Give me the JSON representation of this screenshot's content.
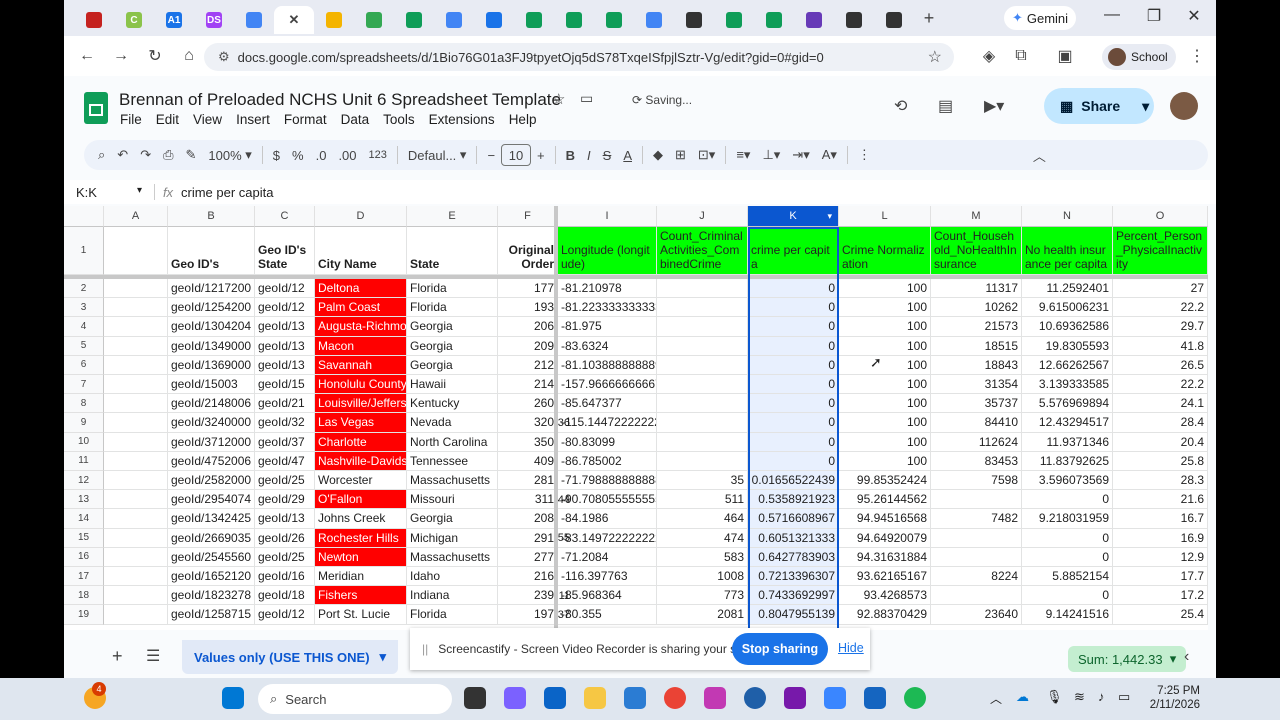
{
  "browser": {
    "tabs": [
      {
        "icon": "record-icon",
        "color": "#c5221f",
        "label": ""
      },
      {
        "icon": "c-icon",
        "color": "#8bc34a",
        "label": "C"
      },
      {
        "icon": "a1-icon",
        "color": "#1a73e8",
        "label": "A1"
      },
      {
        "icon": "ds-icon",
        "color": "#a142f4",
        "label": "DS"
      },
      {
        "icon": "docs-icon",
        "color": "#4285f4",
        "label": ""
      },
      {
        "icon": "close-icon",
        "color": "#444",
        "label": "✕",
        "active": true
      },
      {
        "icon": "slides-icon",
        "color": "#f4b400",
        "label": ""
      },
      {
        "icon": "drive-icon",
        "color": "#34a853",
        "label": ""
      },
      {
        "icon": "sheets-icon",
        "color": "#0f9d58",
        "label": ""
      },
      {
        "icon": "docs-icon",
        "color": "#4285f4",
        "label": ""
      },
      {
        "icon": "globe-icon",
        "color": "#1a73e8",
        "label": ""
      },
      {
        "icon": "sheets-icon",
        "color": "#0f9d58",
        "label": ""
      },
      {
        "icon": "sheets-icon",
        "color": "#0f9d58",
        "label": ""
      },
      {
        "icon": "sheets-icon",
        "color": "#0f9d58",
        "label": ""
      },
      {
        "icon": "docs-icon",
        "color": "#4285f4",
        "label": ""
      },
      {
        "icon": "openai-icon",
        "color": "#333",
        "label": ""
      },
      {
        "icon": "sheets-icon",
        "color": "#0f9d58",
        "label": ""
      },
      {
        "icon": "add-circle-icon",
        "color": "#0f9d58",
        "label": ""
      },
      {
        "icon": "forms-icon",
        "color": "#673ab7",
        "label": ""
      },
      {
        "icon": "github-icon",
        "color": "#333",
        "label": ""
      },
      {
        "icon": "github-icon",
        "color": "#333",
        "label": ""
      }
    ],
    "new_tab": "+",
    "gemini_label": "Gemini",
    "url": "docs.google.com/spreadsheets/d/1Bio76G01a3FJ9tpyetOjq5dS78TxqeISfpjlSztr-Vg/edit?gid=0#gid=0",
    "profile_label": "School"
  },
  "doc": {
    "title": "Brennan of Preloaded NCHS Unit 6 Spreadsheet Template",
    "status": "Saving...",
    "menu": [
      "File",
      "Edit",
      "View",
      "Insert",
      "Format",
      "Data",
      "Tools",
      "Extensions",
      "Help"
    ],
    "share_label": "Share"
  },
  "toolbar": {
    "zoom": "100%",
    "currency": "$",
    "percent": "%",
    "dec_decrease": ".0",
    "dec_increase": ".00",
    "number_format": "123",
    "font": "Defaul...",
    "font_size": "10",
    "bold": "B",
    "italic": "I",
    "strike": "S",
    "text_color": "A"
  },
  "formula_bar": {
    "name_box": "K:K",
    "fx": "fx",
    "content": "crime per capita"
  },
  "columns": [
    "A",
    "B",
    "C",
    "D",
    "E",
    "F",
    "I",
    "J",
    "K",
    "L",
    "M",
    "N",
    "O"
  ],
  "header_row": [
    "",
    "Geo ID's",
    "Geo ID's State",
    "City Name",
    "State",
    "Original Order",
    "Longitude (longitude)",
    "Count_Criminal Activities_CombinedCrime",
    "crime per capita",
    "Crime Normalization",
    "Count_Household_NoHealthInsurance",
    "No health insurance per capita",
    "Percent_Person_PhysicalInactivity"
  ],
  "rows": [
    {
      "n": "2",
      "cells": [
        "",
        "geoId/1217200",
        "geoId/12",
        "Deltona",
        "Florida",
        "177",
        "-81.210978",
        "",
        "0",
        "100",
        "11317",
        "11.2592401",
        "27"
      ],
      "red": true
    },
    {
      "n": "3",
      "cells": [
        "",
        "geoId/1254200",
        "geoId/12",
        "Palm Coast",
        "Florida",
        "193",
        "-81.223333333333",
        "",
        "0",
        "100",
        "10262",
        "9.615006231",
        "22.2"
      ],
      "red": true
    },
    {
      "n": "4",
      "cells": [
        "",
        "geoId/1304204",
        "geoId/13",
        "Augusta-Richmond",
        "Georgia",
        "206",
        "-81.975",
        "",
        "0",
        "100",
        "21573",
        "10.69362586",
        "29.7"
      ],
      "red": true
    },
    {
      "n": "5",
      "cells": [
        "",
        "geoId/1349000",
        "geoId/13",
        "Macon",
        "Georgia",
        "209",
        "-83.6324",
        "",
        "0",
        "100",
        "18515",
        "19.8305593",
        "41.8"
      ],
      "red": true
    },
    {
      "n": "6",
      "cells": [
        "",
        "geoId/1369000",
        "geoId/13",
        "Savannah",
        "Georgia",
        "212",
        "-81.103888888889",
        "",
        "0",
        "100",
        "18843",
        "12.66262567",
        "26.5"
      ],
      "red": true
    },
    {
      "n": "7",
      "cells": [
        "",
        "geoId/15003",
        "geoId/15",
        "Honolulu County",
        "Hawaii",
        "214",
        "-157.96666666667",
        "",
        "0",
        "100",
        "31354",
        "3.139333585",
        "22.2"
      ],
      "red": true
    },
    {
      "n": "8",
      "cells": [
        "",
        "geoId/2148006",
        "geoId/21",
        "Louisville/Jefferson",
        "Kentucky",
        "260",
        "-85.647377",
        "",
        "0",
        "100",
        "35737",
        "5.576969894",
        "24.1"
      ],
      "red": true
    },
    {
      "n": "9",
      "cells": [
        "",
        "geoId/3240000",
        "geoId/32",
        "Las Vegas",
        "Nevada",
        "320",
        "-115.14472222222",
        "",
        "0",
        "100",
        "84410",
        "12.43294517",
        "28.4"
      ],
      "red": true,
      "spill": "36"
    },
    {
      "n": "10",
      "cells": [
        "",
        "geoId/3712000",
        "geoId/37",
        "Charlotte",
        "North Carolina",
        "350",
        "-80.83099",
        "",
        "0",
        "100",
        "112624",
        "11.9371346",
        "20.4"
      ],
      "red": true
    },
    {
      "n": "11",
      "cells": [
        "",
        "geoId/4752006",
        "geoId/47",
        "Nashville-Davidson",
        "Tennessee",
        "409",
        "-86.785002",
        "",
        "0",
        "100",
        "83453",
        "11.83792625",
        "25.8"
      ],
      "red": true
    },
    {
      "n": "12",
      "cells": [
        "",
        "geoId/2582000",
        "geoId/25",
        "Worcester",
        "Massachusetts",
        "281",
        "-71.798888888888",
        "35",
        "0.01656522439",
        "99.85352424",
        "7598",
        "3.596073569",
        "28.3"
      ],
      "red": false
    },
    {
      "n": "13",
      "cells": [
        "",
        "geoId/2954074",
        "geoId/29",
        "O'Fallon",
        "Missouri",
        "311",
        "-90.708055555555",
        "511",
        "0.5358921923",
        "95.26144562",
        "",
        "0",
        "21.6"
      ],
      "red": true,
      "spill": "44"
    },
    {
      "n": "14",
      "cells": [
        "",
        "geoId/1342425",
        "geoId/13",
        "Johns Creek",
        "Georgia",
        "208",
        "-84.1986",
        "464",
        "0.5716608967",
        "94.94516568",
        "7482",
        "9.218031959",
        "16.7"
      ],
      "red": false
    },
    {
      "n": "15",
      "cells": [
        "",
        "geoId/2669035",
        "geoId/26",
        "Rochester Hills",
        "Michigan",
        "291",
        "-83.149722222222",
        "474",
        "0.6051321333",
        "94.64920079",
        "",
        "0",
        "16.9"
      ],
      "red": true,
      "spill": "55"
    },
    {
      "n": "16",
      "cells": [
        "",
        "geoId/2545560",
        "geoId/25",
        "Newton",
        "Massachusetts",
        "277",
        "-71.2084",
        "583",
        "0.6427783903",
        "94.31631884",
        "",
        "0",
        "12.9"
      ],
      "red": true
    },
    {
      "n": "17",
      "cells": [
        "",
        "geoId/1652120",
        "geoId/16",
        "Meridian",
        "Idaho",
        "216",
        "-116.397763",
        "1008",
        "0.7213396307",
        "93.62165167",
        "8224",
        "5.8852154",
        "17.7"
      ],
      "red": false
    },
    {
      "n": "18",
      "cells": [
        "",
        "geoId/1823278",
        "geoId/18",
        "Fishers",
        "Indiana",
        "239",
        "-85.968364",
        "773",
        "0.7433692997",
        "93.4268573",
        "",
        "0",
        "17.2"
      ],
      "red": true,
      "spill": "11"
    },
    {
      "n": "19",
      "cells": [
        "",
        "geoId/1258715",
        "geoId/12",
        "Port St. Lucie",
        "Florida",
        "197",
        "-80.355",
        "2081",
        "0.8047955139",
        "92.88370429",
        "23640",
        "9.14241516",
        "25.4"
      ],
      "red": false,
      "spill": "37"
    }
  ],
  "bottom": {
    "add_sheet": "+",
    "sheet_tab": "Values only (USE THIS ONE)",
    "share_msg": "Screencastify - Screen Video Recorder is sharing your screen.",
    "stop_label": "Stop sharing",
    "hide_label": "Hide",
    "sum_label": "Sum: 1,442.33"
  },
  "taskbar": {
    "search_placeholder": "Search",
    "time": "7:25 PM",
    "date": "2/11/2026",
    "badge": "4"
  }
}
